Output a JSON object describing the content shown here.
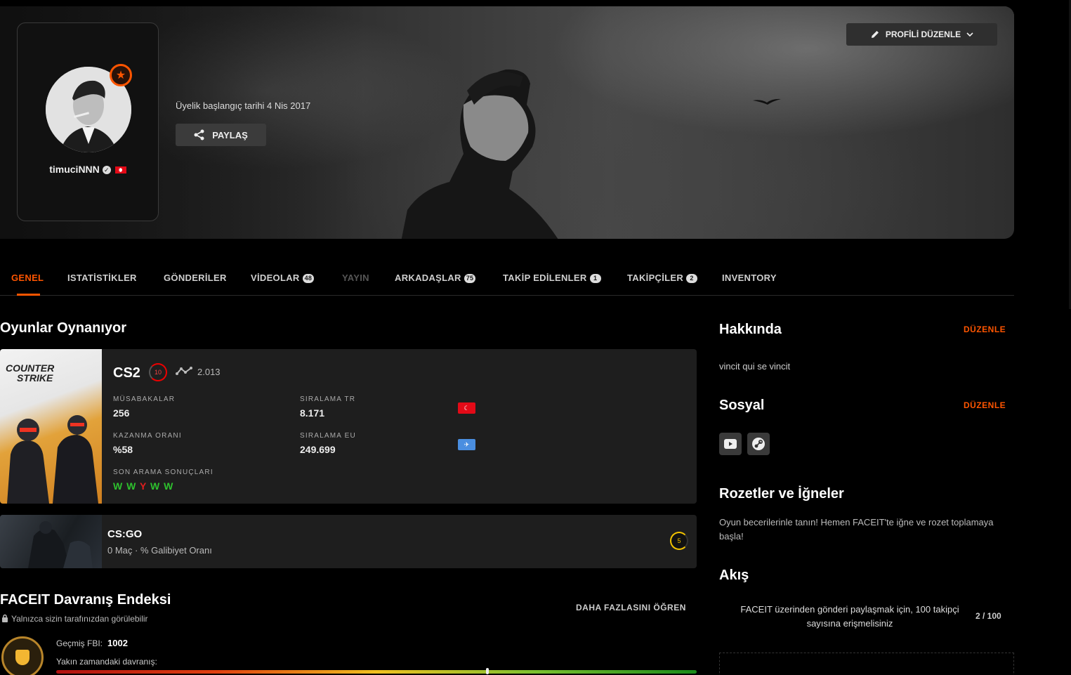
{
  "profile": {
    "username": "timuciNNN",
    "member_since": "Üyelik başlangıç tarihi 4 Nis 2017",
    "share_label": "PAYLAŞ",
    "edit_profile_label": "PROFİLİ DÜZENLE",
    "country_flag": "TR"
  },
  "tabs": [
    {
      "label": "GENEL",
      "state": "active"
    },
    {
      "label": "ISTATİSTİKLER"
    },
    {
      "label": "GÖNDERİLER"
    },
    {
      "label": "VİDEOLAR",
      "count": "48"
    },
    {
      "label": "YAYIN",
      "state": "disabled"
    },
    {
      "label": "ARKADAŞLAR",
      "count": "75"
    },
    {
      "label": "TAKİP EDİLENLER",
      "count": "1"
    },
    {
      "label": "TAKİPÇİLER",
      "count": "2"
    },
    {
      "label": "INVENTORY"
    }
  ],
  "games": {
    "section_title": "Oyunlar Oynanıyor",
    "cs2": {
      "art_text_line1": "COUNTER",
      "art_text_line2": "STRIKE",
      "title": "CS2",
      "level": "10",
      "elo": "2.013",
      "matches_label": "MÜSABAKALAR",
      "matches_value": "256",
      "winrate_label": "KAZANMA ORANI",
      "winrate_value": "%58",
      "rank_tr_label": "SIRALAMA TR",
      "rank_tr_value": "8.171",
      "rank_eu_label": "SIRALAMA EU",
      "rank_eu_value": "249.699",
      "recent_label": "SON ARAMA SONUÇLARI",
      "recent_results": [
        "W",
        "W",
        "Y",
        "W",
        "W"
      ]
    },
    "csgo": {
      "title": "CS:GO",
      "subtitle": "0 Maç · % Galibiyet Oranı",
      "level": "5"
    }
  },
  "fbi": {
    "title": "FACEIT Davranış Endeksi",
    "private_note": "Yalnızca sizin tarafınızdan görülebilir",
    "learn_more": "DAHA FAZLASINI ÖĞREN",
    "past_label": "Geçmiş FBI:",
    "past_value": "1002",
    "recent_label": "Yakın zamandaki davranış:",
    "recent_position": 0.673
  },
  "sidebar": {
    "about_title": "Hakkında",
    "about_edit": "DÜZENLE",
    "about_text": "vincit qui se vincit",
    "social_title": "Sosyal",
    "social_edit": "DÜZENLE",
    "social_links": [
      "youtube-icon",
      "steam-icon"
    ],
    "badges_title": "Rozetler ve İğneler",
    "badges_text": "Oyun becerilerinle tanın! Hemen FACEIT'te iğne ve rozet toplamaya başla!",
    "feed_title": "Akış",
    "feed_text": "FACEIT üzerinden gönderi paylaşmak için, 100 takipçi sayısına erişmelisiniz",
    "feed_count": "2 / 100"
  },
  "colors": {
    "accent": "#ff5500",
    "win": "#2ec12e",
    "loss": "#e01e1e"
  }
}
